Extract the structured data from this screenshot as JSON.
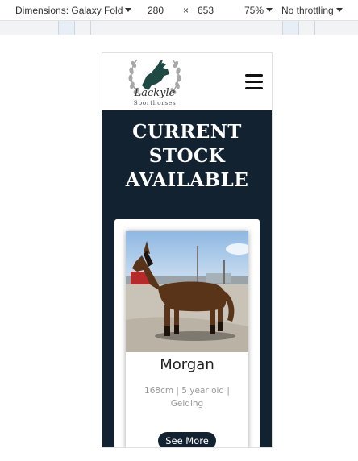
{
  "devtools": {
    "dimensions_label": "Dimensions: Galaxy Fold",
    "width": "280",
    "times": "×",
    "height": "653",
    "zoom": "75%",
    "throttling": "No throttling"
  },
  "site": {
    "logo": {
      "script_text": "Lackyle",
      "subtext": "Sporthorses"
    },
    "hero_title_lines": [
      "CURRENT",
      "STOCK",
      "AVAILABLE"
    ],
    "horse": {
      "name": "Morgan",
      "meta_line1": "168cm | 5 year old |",
      "meta_line2": "Gelding",
      "button_label": "See More"
    }
  },
  "colors": {
    "navy": "#132231",
    "white": "#ffffff"
  },
  "icons": {
    "menu": "hamburger-icon",
    "dropdown": "chevron-down-icon"
  }
}
